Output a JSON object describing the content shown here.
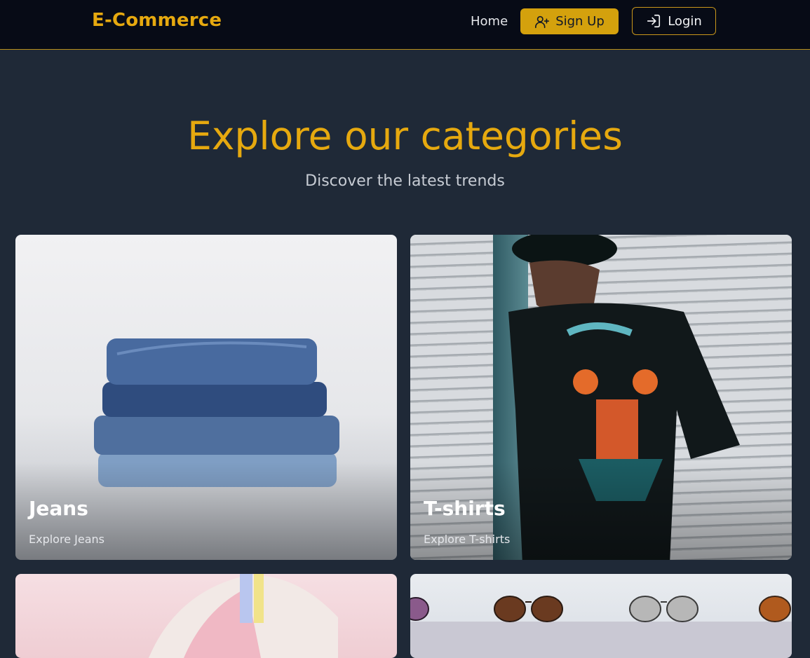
{
  "navbar": {
    "brand": "E-Commerce",
    "home_label": "Home",
    "signup_label": "Sign Up",
    "signup_icon": "user-plus-icon",
    "login_label": "Login",
    "login_icon": "login-arrow-icon"
  },
  "hero": {
    "title": "Explore our categories",
    "subtitle": "Discover the latest trends"
  },
  "categories": [
    {
      "name": "Jeans",
      "link": "Explore Jeans"
    },
    {
      "name": "T-shirts",
      "link": "Explore T-shirts"
    },
    {
      "name": "",
      "link": ""
    },
    {
      "name": "",
      "link": ""
    }
  ],
  "colors": {
    "accent": "#e6a90f",
    "navbar_bg": "#070b16",
    "page_bg": "#1f2937",
    "signup_bg": "#d4a10d"
  }
}
